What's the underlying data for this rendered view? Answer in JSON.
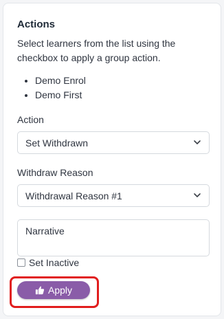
{
  "panel": {
    "title": "Actions",
    "description": "Select learners from the list using the checkbox to apply a group action.",
    "selected_learners": [
      "Demo Enrol",
      "Demo First"
    ]
  },
  "action_field": {
    "label": "Action",
    "selected": "Set Withdrawn",
    "icon": "chevron-down-icon"
  },
  "withdraw_reason_field": {
    "label": "Withdraw Reason",
    "selected": "Withdrawal Reason #1",
    "icon": "chevron-down-icon"
  },
  "narrative": {
    "placeholder": "Narrative",
    "value": ""
  },
  "set_inactive": {
    "label": "Set Inactive",
    "checked": false
  },
  "apply_button": {
    "label": "Apply",
    "icon": "thumbs-up-icon",
    "color": "#8a5ca8"
  },
  "highlight": {
    "color": "#e11d1d"
  }
}
